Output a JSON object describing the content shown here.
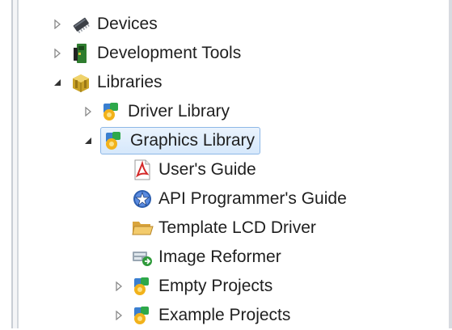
{
  "tree": {
    "items": [
      {
        "label": "Devices",
        "icon": "chip-icon",
        "toggle": "collapsed"
      },
      {
        "label": "Development Tools",
        "icon": "board-icon",
        "toggle": "collapsed"
      },
      {
        "label": "Libraries",
        "icon": "package-icon",
        "toggle": "expanded"
      },
      {
        "label": "Driver Library",
        "icon": "library-icon",
        "toggle": "collapsed"
      },
      {
        "label": "Graphics Library",
        "icon": "library-icon",
        "toggle": "expanded",
        "selected": true
      },
      {
        "label": "User's Guide",
        "icon": "pdf-icon"
      },
      {
        "label": "API Programmer's Guide",
        "icon": "help-icon"
      },
      {
        "label": "Template LCD Driver",
        "icon": "folder-icon"
      },
      {
        "label": "Image Reformer",
        "icon": "tool-icon"
      },
      {
        "label": "Empty Projects",
        "icon": "library-icon",
        "toggle": "collapsed"
      },
      {
        "label": "Example Projects",
        "icon": "library-icon",
        "toggle": "collapsed"
      }
    ]
  },
  "colors": {
    "selection_fill": "#d6e8fb",
    "selection_border": "#8db7e6",
    "text": "#1f1f1f"
  }
}
